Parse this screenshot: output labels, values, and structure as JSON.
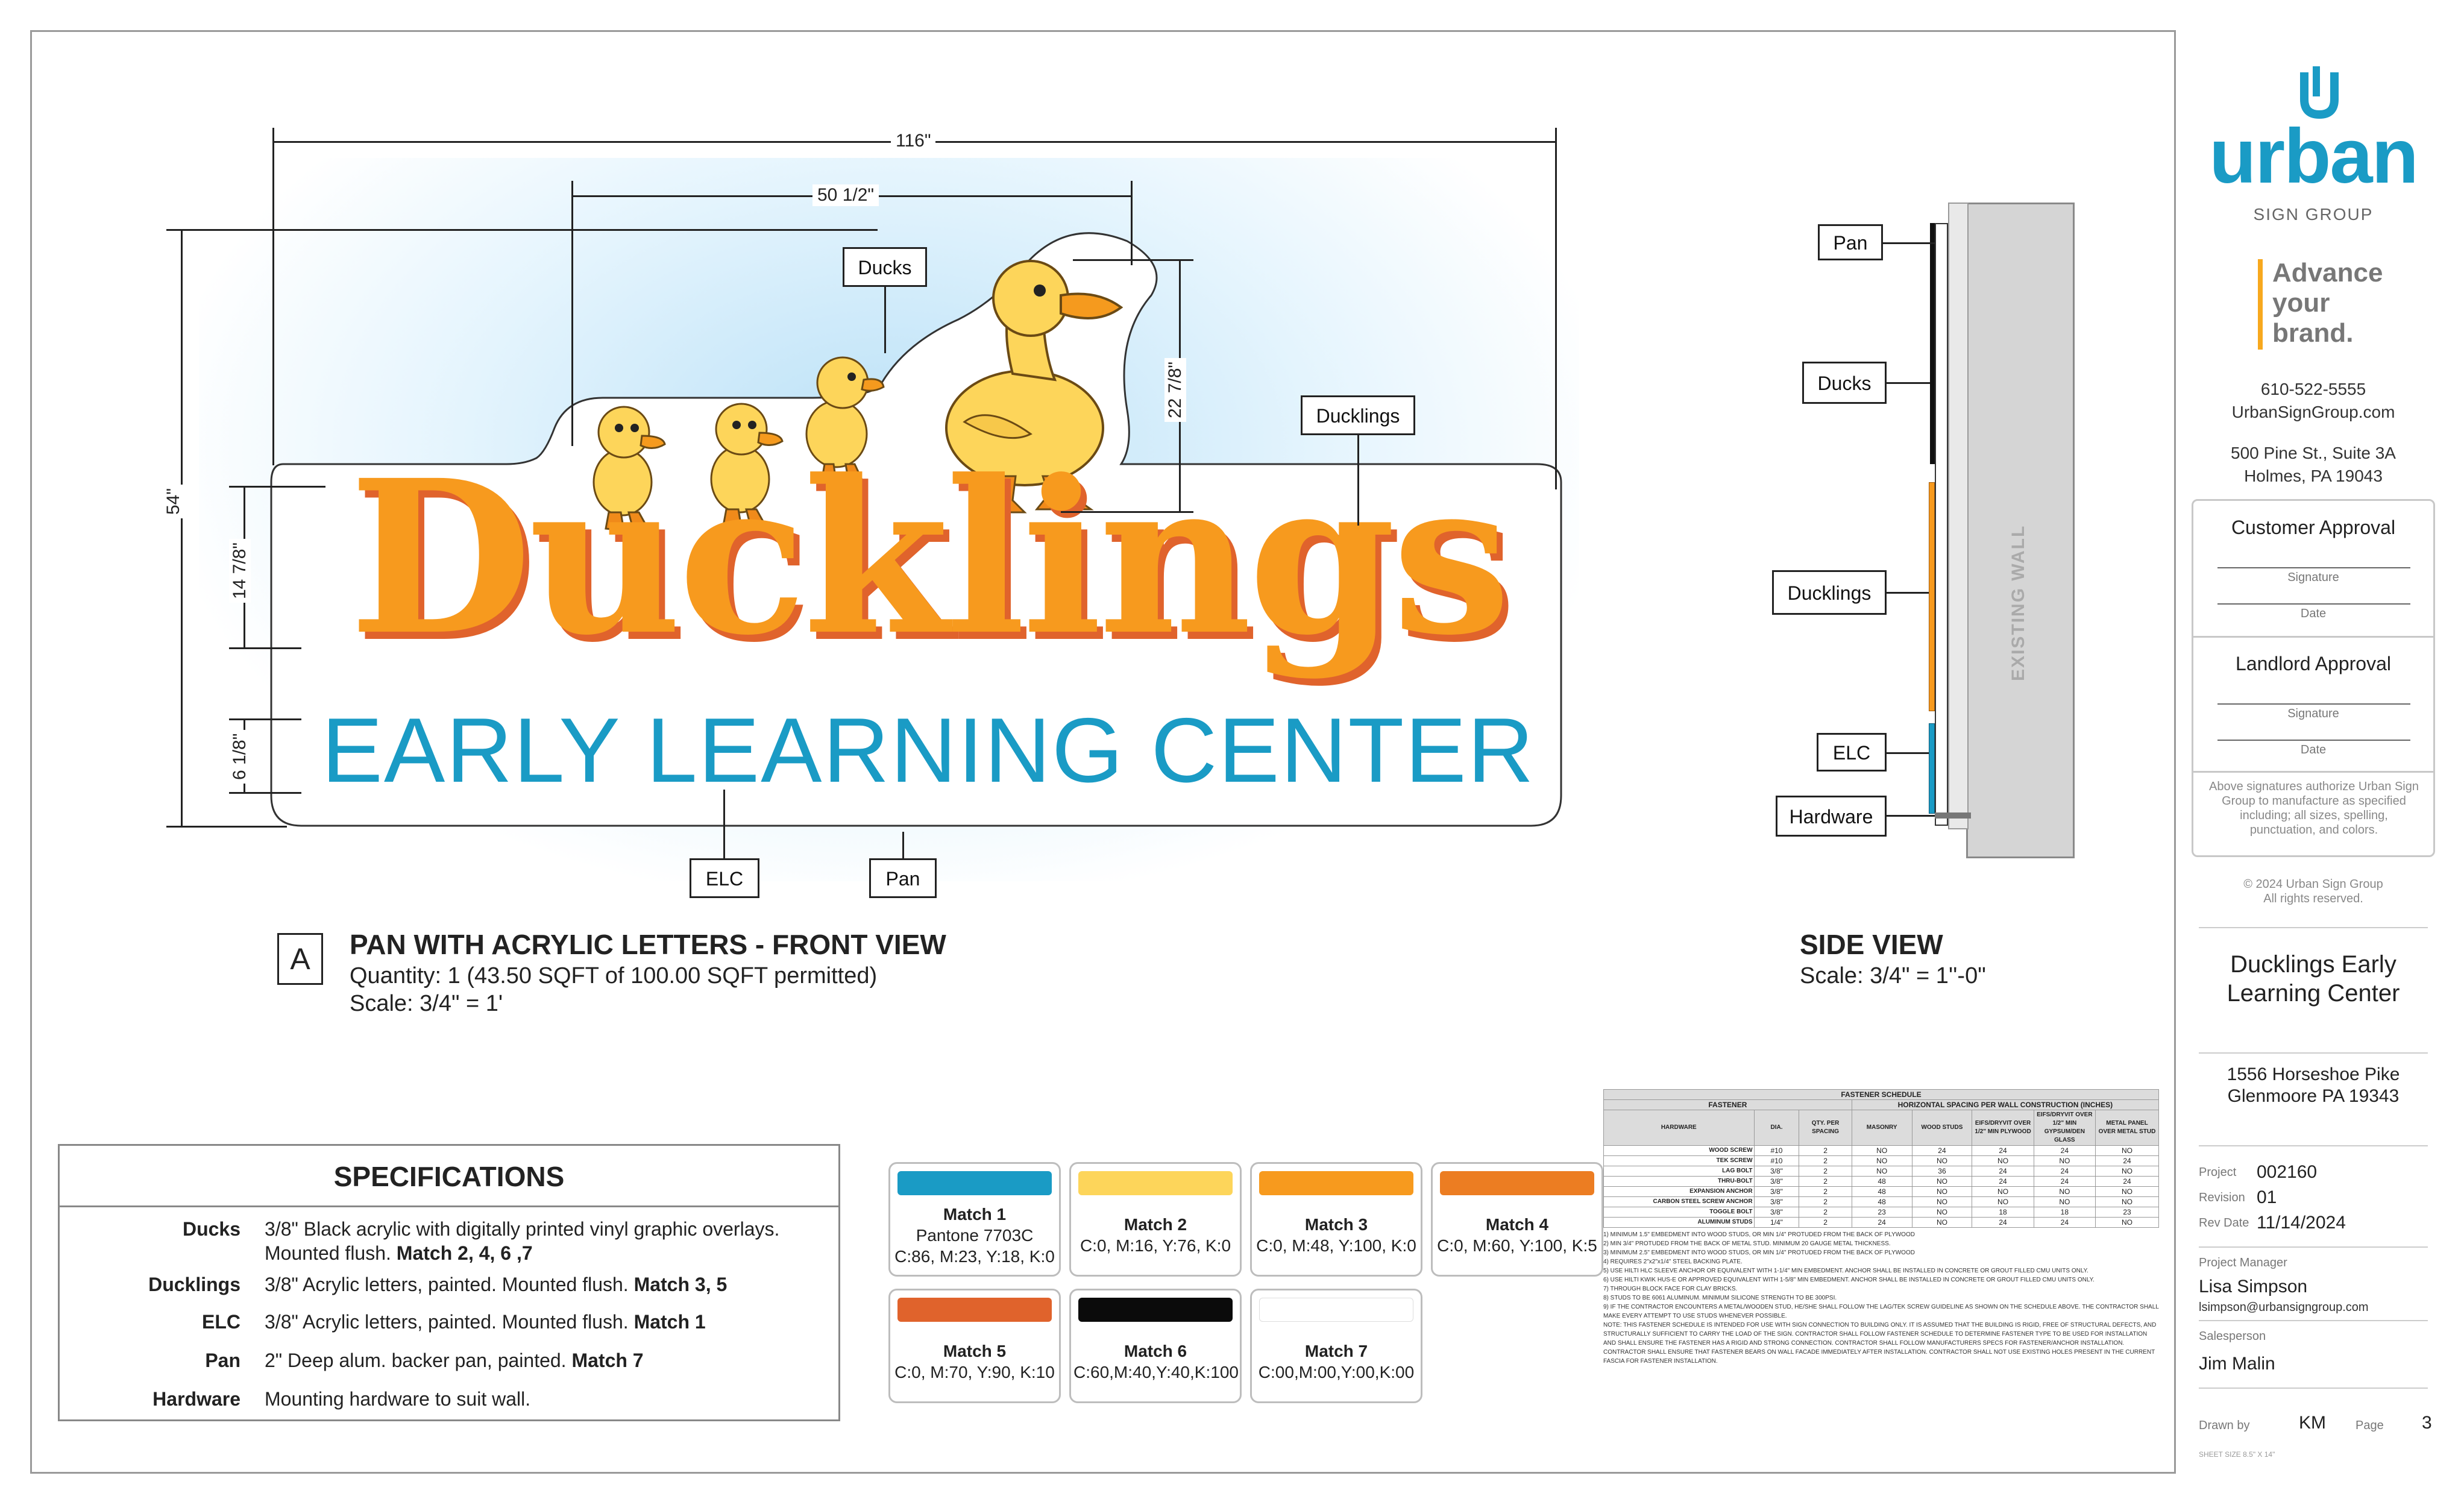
{
  "dimensions": {
    "overall_width": "116\"",
    "letters_width": "50 1/2\"",
    "overall_height": "54\"",
    "duck_height": "22 7/8\"",
    "ducklings_height": "14 7/8\"",
    "elc_height": "6 1/8\""
  },
  "sign": {
    "main_text": "Ducklings",
    "sub_text": "EARLY LEARNING CENTER"
  },
  "callouts": {
    "ducks": "Ducks",
    "ducklings": "Ducklings",
    "elc": "ELC",
    "pan": "Pan",
    "hardware": "Hardware"
  },
  "front_view": {
    "letter": "A",
    "title": "PAN WITH ACRYLIC LETTERS - FRONT VIEW",
    "quantity": "Quantity: 1  (43.50 SQFT of 100.00 SQFT permitted)",
    "scale": "Scale: 3/4\" = 1'"
  },
  "side_view": {
    "title": "SIDE VIEW",
    "scale": "Scale: 3/4\" = 1''-0\"",
    "wall_label": "EXISTING WALL"
  },
  "specifications": {
    "title": "SPECIFICATIONS",
    "rows": [
      {
        "key": "Ducks",
        "line1": "3/8\" Black acrylic with digitally printed vinyl graphic overlays.",
        "line2": "Mounted flush. ",
        "match": "Match 2, 4, 6 ,7"
      },
      {
        "key": "Ducklings",
        "line1": "3/8\" Acrylic letters, painted. Mounted flush. ",
        "line2": "",
        "match": "Match 3, 5"
      },
      {
        "key": "ELC",
        "line1": "3/8\" Acrylic letters, painted. Mounted flush. ",
        "line2": "",
        "match": "Match 1"
      },
      {
        "key": "Pan",
        "line1": "2\" Deep alum. backer pan, painted. ",
        "line2": "",
        "match": "Match 7"
      },
      {
        "key": "Hardware",
        "line1": "Mounting hardware to suit wall.",
        "line2": "",
        "match": ""
      }
    ]
  },
  "swatches": [
    {
      "name": "Match 1",
      "l1": "Pantone 7703C",
      "l2": "C:86, M:23, Y:18, K:0",
      "color": "#1a9bc5"
    },
    {
      "name": "Match 2",
      "l1": "C:0, M:16, Y:76, K:0",
      "l2": "",
      "color": "#fdd55a"
    },
    {
      "name": "Match 3",
      "l1": "C:0, M:48, Y:100, K:0",
      "l2": "",
      "color": "#f79a1e"
    },
    {
      "name": "Match 4",
      "l1": "C:0, M:60, Y:100, K:5",
      "l2": "",
      "color": "#ec7d22"
    },
    {
      "name": "Match 5",
      "l1": "C:0, M:70, Y:90, K:10",
      "l2": "",
      "color": "#e0632c"
    },
    {
      "name": "Match 6",
      "l1": "C:60,M:40,Y:40,K:100",
      "l2": "",
      "color": "#0b0b0b"
    },
    {
      "name": "Match 7",
      "l1": "C:00,M:00,Y:00,K:00",
      "l2": "",
      "color": "#ffffff"
    }
  ],
  "fastener_schedule": {
    "title": "FASTENER SCHEDULE",
    "group_fastener": "FASTENER",
    "group_spacing": "HORIZONTAL SPACING PER WALL CONSTRUCTION (INCHES)",
    "columns": [
      "HARDWARE",
      "DIA.",
      "QTY. PER SPACING",
      "MASONRY",
      "WOOD STUDS",
      "EIFS/DRYVIT OVER 1/2\" MIN PLYWOOD",
      "EIFS/DRYVIT OVER 1/2\" MIN GYPSUM/DEN GLASS",
      "METAL PANEL OVER METAL STUD"
    ],
    "rows": [
      [
        "WOOD SCREW",
        "#10",
        "2",
        "NO",
        "24",
        "24",
        "24",
        "NO"
      ],
      [
        "TEK SCREW",
        "#10",
        "2",
        "NO",
        "NO",
        "NO",
        "NO",
        "24"
      ],
      [
        "LAG BOLT",
        "3/8\"",
        "2",
        "NO",
        "36",
        "24",
        "24",
        "NO"
      ],
      [
        "THRU-BOLT",
        "3/8\"",
        "2",
        "48",
        "NO",
        "24",
        "24",
        "24"
      ],
      [
        "EXPANSION ANCHOR",
        "3/8\"",
        "2",
        "48",
        "NO",
        "NO",
        "NO",
        "NO"
      ],
      [
        "CARBON STEEL SCREW ANCHOR",
        "3/8\"",
        "2",
        "48",
        "NO",
        "NO",
        "NO",
        "NO"
      ],
      [
        "TOGGLE BOLT",
        "3/8\"",
        "2",
        "23",
        "NO",
        "18",
        "18",
        "23"
      ],
      [
        "ALUMINUM STUDS",
        "1/4\"",
        "2",
        "24",
        "NO",
        "24",
        "24",
        "NO"
      ]
    ],
    "notes": [
      "1) MINIMUM 1.5\" EMBEDMENT INTO WOOD STUDS, OR MIN 1/4\" PROTUDED FROM THE BACK OF PLYWOOD",
      "2) MIN 3/4\" PROTUDED FROM THE BACK OF METAL STUD. MINIMUM 20 GAUGE METAL THICKNESS.",
      "3) MINIMUM 2.5\" EMBEDMENT INTO WOOD STUDS, OR MIN 1/4\" PROTUDED FROM THE BACK OF PLYWOOD",
      "4) REQUIRES 2\"x2\"x1/4\" STEEL BACKING PLATE.",
      "5) USE HILTI HLC SLEEVE ANCHOR OR EQUIVALENT WITH 1-1/4\" MIN EMBEDMENT. ANCHOR SHALL BE INSTALLED IN CONCRETE OR GROUT FILLED CMU UNITS ONLY.",
      "6) USE HILTI KWIK HUS-E OR APPROVED EQUIVALENT WITH 1-5/8\" MIN EMBEDMENT. ANCHOR SHALL BE INSTALLED IN CONCRETE OR GROUT FILLED CMU UNITS ONLY.",
      "7) THROUGH BLOCK FACE FOR CLAY BRICKS.",
      "8) STUDS TO BE 6061 ALUMINUM. MINIMUM SILICONE STRENGTH TO BE 300PSI.",
      "9) IF THE CONTRACTOR ENCOUNTERS A METAL/WOODEN STUD, HE/SHE SHALL FOLLOW THE LAG/TEK SCREW GUIDELINE AS SHOWN ON THE SCHEDULE ABOVE. THE CONTRACTOR SHALL MAKE EVERY ATTEMPT TO USE STUDS WHENEVER POSSIBLE.",
      "NOTE: THIS FASTENER SCHEDULE IS INTENDED FOR USE WITH SIGN CONNECTION TO BUILDING ONLY. IT IS ASSUMED THAT THE BUILDING IS RIGID, FREE OF STRUCTURAL DEFECTS, AND STRUCTURALLY SUFFICIENT TO CARRY THE LOAD OF THE SIGN. CONTRACTOR SHALL FOLLOW FASTENER SCHEDULE TO DETERMINE FASTENER TYPE TO BE USED FOR INSTALLATION AND SHALL ENSURE THE FASTENER HAS A RIGID AND STRONG CONNECTION. CONTRACTOR SHALL FOLLOW MANUFACTURERS SPECS FOR FASTENER/ANCHOR INSTALLATION. CONTRACTOR SHALL ENSURE THAT FASTENER BEARS ON WALL FACADE IMMEDIATELY AFTER INSTALLATION. CONTRACTOR SHALL NOT USE EXISTING HOLES PRESENT IN THE CURRENT FASCIA FOR FASTENER INSTALLATION."
    ]
  },
  "company": {
    "logo_word": "urban",
    "logo_sub": "SIGN GROUP",
    "tagline": [
      "Advance",
      "your",
      "brand."
    ],
    "phone": "610-522-5555",
    "website": "UrbanSignGroup.com",
    "address1": "500 Pine St., Suite 3A",
    "address2": "Holmes, PA 19043"
  },
  "approvals": {
    "customer": "Customer Approval",
    "landlord": "Landlord Approval",
    "signature": "Signature",
    "date": "Date",
    "disclaimer": "Above signatures authorize Urban Sign Group to manufacture as specified including; all sizes, spelling, punctuation, and colors.",
    "copyright1": "© 2024 Urban Sign Group",
    "copyright2": "All rights reserved."
  },
  "project": {
    "name_line1": "Ducklings Early",
    "name_line2": "Learning Center",
    "addr1": "1556 Horseshoe Pike",
    "addr2": "Glenmoore PA 19343",
    "project_label": "Project",
    "project_value": "002160",
    "revision_label": "Revision",
    "revision_value": "01",
    "revdate_label": "Rev Date",
    "revdate_value": "11/14/2024",
    "pm_label": "Project Manager",
    "pm_name": "Lisa Simpson",
    "pm_email": "lsimpson@urbansigngroup.com",
    "sales_label": "Salesperson",
    "sales_name": "Jim Malin",
    "drawn_label": "Drawn by",
    "drawn_value": "KM",
    "page_label": "Page",
    "page_value": "3",
    "sheet_size": "SHEET SIZE 8.5\" X 14\""
  }
}
